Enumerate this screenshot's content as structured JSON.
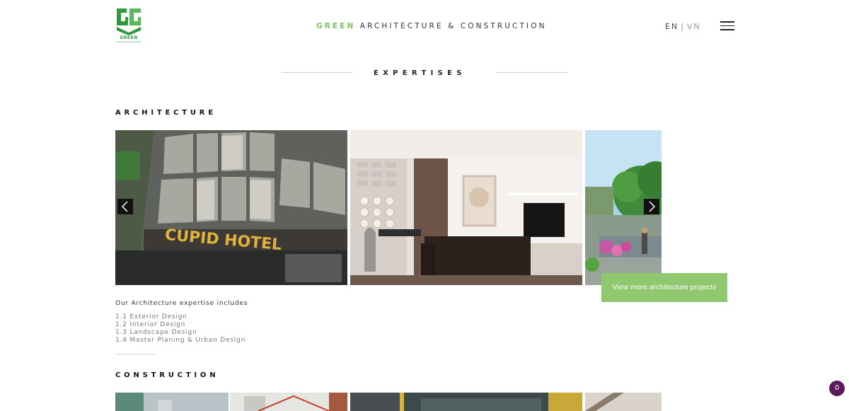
{
  "header": {
    "logo_text": "GREEN",
    "logo_subtext": "Architecture & Construction",
    "brand_highlight": "GREEN",
    "brand_rest": "ARCHITECTURE & CONSTRUCTION",
    "lang_en": "EN",
    "lang_separator": "|",
    "lang_vn": "VN"
  },
  "section": {
    "title": "EXPERTISES"
  },
  "architecture": {
    "title": "ARCHITECTURE",
    "slides": [
      {
        "name": "cupid-hotel-facade",
        "sign_text": "CUPID HOTEL"
      },
      {
        "name": "living-room-interior"
      },
      {
        "name": "landscape-garden"
      }
    ],
    "cta_label": "View more architecture projects",
    "intro": "Our Architecture expertise includes",
    "items": [
      "1.1 Exterior Design",
      "1.2 Interior Design",
      "1.3 Landscape Design",
      "1.4 Master Planing & Urban Design"
    ]
  },
  "construction": {
    "title": "CONSTRUCTION"
  },
  "chat": {
    "count": "0"
  },
  "colors": {
    "accent_green": "#7dc263",
    "cta_green": "#8fc86f",
    "chat_purple": "#5b1a5b"
  },
  "icons": {
    "menu": "hamburger-icon",
    "prev": "chevron-left-icon",
    "next": "chevron-right-icon"
  }
}
